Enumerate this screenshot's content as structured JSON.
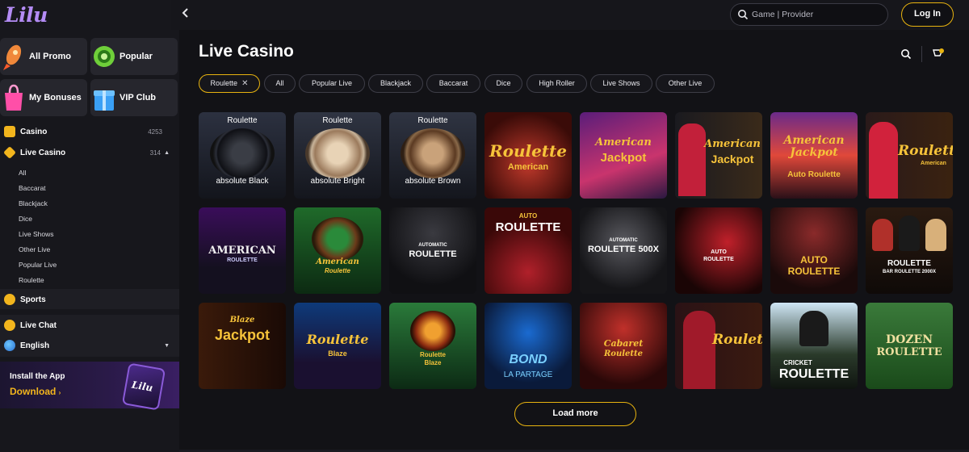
{
  "brand": {
    "logo": "Lilu"
  },
  "header": {
    "search_placeholder": "Game | Provider",
    "login_label": "Log In"
  },
  "sidebar": {
    "tiles": [
      {
        "label": "All Promo",
        "icon": "rocket-icon"
      },
      {
        "label": "Popular",
        "icon": "slot-chip-icon"
      },
      {
        "label": "My Bonuses",
        "icon": "shopping-bag-icon"
      },
      {
        "label": "VIP Club",
        "icon": "gift-box-icon"
      }
    ],
    "nav": [
      {
        "label": "Casino",
        "count": "4253",
        "icon": "dice-icon"
      },
      {
        "label": "Live Casino",
        "count": "314",
        "icon": "diamond-icon",
        "expanded": true
      }
    ],
    "live_casino_sub": [
      "All",
      "Baccarat",
      "Blackjack",
      "Dice",
      "Live Shows",
      "Other Live",
      "Popular Live",
      "Roulette"
    ],
    "sports_label": "Sports",
    "live_chat_label": "Live Chat",
    "language_label": "English",
    "app_banner": {
      "title": "Install the App",
      "link": "Download",
      "phone_logo": "Lilu"
    }
  },
  "main": {
    "title": "Live Casino",
    "filters": [
      {
        "label": "Roulette",
        "active": true
      },
      {
        "label": "All"
      },
      {
        "label": "Popular Live"
      },
      {
        "label": "Blackjack"
      },
      {
        "label": "Baccarat"
      },
      {
        "label": "Dice"
      },
      {
        "label": "High Roller"
      },
      {
        "label": "Live Shows"
      },
      {
        "label": "Other Live"
      }
    ],
    "games": [
      {
        "title": "Roulette",
        "sub": "absolute Black",
        "theme": "wheel-dark"
      },
      {
        "title": "Roulette",
        "sub": "absolute Bright",
        "theme": "wheel-bright"
      },
      {
        "title": "Roulette",
        "sub": "absolute Brown",
        "theme": "wheel-brown"
      },
      {
        "title": "Roulette",
        "sub": "American",
        "theme": "gold-red"
      },
      {
        "title": "American",
        "sub": "Jackpot",
        "theme": "purple"
      },
      {
        "title": "American",
        "sub": "Jackpot",
        "theme": "dealer-gold"
      },
      {
        "title": "American Jackpot",
        "sub": "Auto Roulette",
        "theme": "sunset"
      },
      {
        "title": "Roulette",
        "sub": "American",
        "theme": "dealer-red"
      },
      {
        "title": "AMERICAN",
        "sub": "ROULETTE",
        "theme": "neon-purple"
      },
      {
        "title": "American",
        "sub": "Roulette",
        "theme": "green-table"
      },
      {
        "title": "AUTOMATIC",
        "sub": "ROULETTE",
        "theme": "dark-wheel"
      },
      {
        "title": "AUTO",
        "sub": "ROULETTE",
        "theme": "red-wheel"
      },
      {
        "title": "AUTOMATIC",
        "sub": "ROULETTE 500X",
        "theme": "steel-wheel"
      },
      {
        "title": "AUTO",
        "sub": "ROULETTE",
        "theme": "red-zoom"
      },
      {
        "title": "AUTO",
        "sub": "ROULETTE",
        "theme": "maroon"
      },
      {
        "title": "ROULETTE",
        "sub": "BAR ROULETTE 2000X",
        "theme": "bar-dealers"
      },
      {
        "title": "Blaze",
        "sub": "Jackpot",
        "theme": "blaze"
      },
      {
        "title": "Roulette",
        "sub": "Blaze",
        "theme": "blue-blaze"
      },
      {
        "title": "Roulette",
        "sub": "Blaze",
        "theme": "green-fire"
      },
      {
        "title": "BOND",
        "sub": "LA PARTAGE",
        "theme": "blue-bond"
      },
      {
        "title": "Cabaret",
        "sub": "Roulette",
        "theme": "cabaret"
      },
      {
        "title": "Roulette",
        "sub": "",
        "theme": "dealer-red-dress"
      },
      {
        "title": "CRICKET",
        "sub": "ROULETTE",
        "theme": "cricket"
      },
      {
        "title": "DOZEN",
        "sub": "ROULETTE",
        "theme": "dozen"
      }
    ],
    "load_more_label": "Load more"
  },
  "colors": {
    "accent": "#e8b30f",
    "purple_brand": "#b48cf5",
    "background": "#121216"
  }
}
